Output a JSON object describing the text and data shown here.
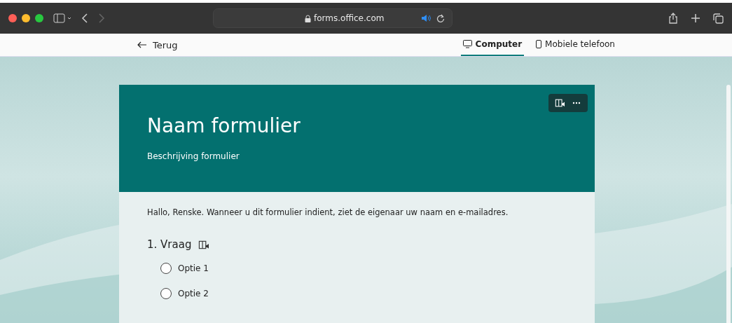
{
  "browser": {
    "url": "forms.office.com"
  },
  "nav": {
    "back": "Terug",
    "tabs": [
      {
        "label": "Computer",
        "kind": "computer",
        "selected": true
      },
      {
        "label": "Mobiele telefoon",
        "kind": "phone",
        "selected": false
      }
    ]
  },
  "form": {
    "title": "Naam formulier",
    "description": "Beschrijving formulier",
    "notice": "Hallo, Renske. Wanneer u dit formulier indient, ziet de eigenaar uw naam en e-mailadres.",
    "questions": [
      {
        "number": "1.",
        "title": "Vraag",
        "options": [
          {
            "label": "Optie 1",
            "selected": false
          },
          {
            "label": "Optie 2",
            "selected": false
          }
        ]
      }
    ]
  }
}
